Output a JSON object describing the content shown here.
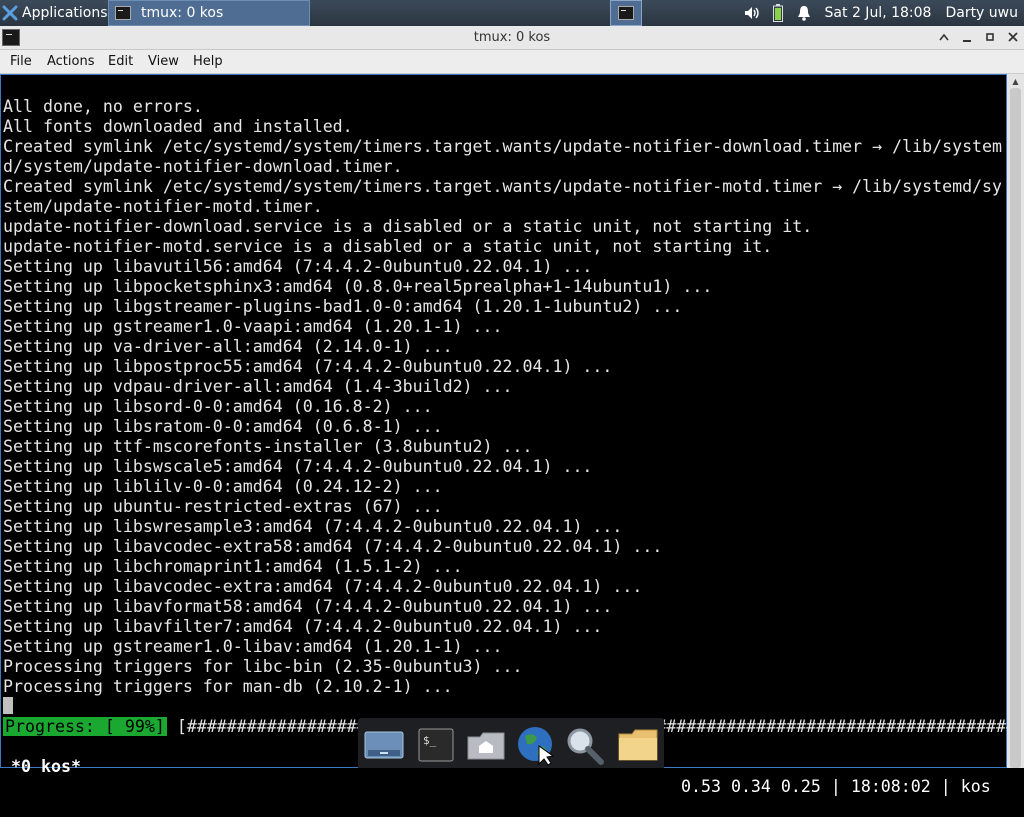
{
  "top_panel": {
    "applications_label": "Applications",
    "task_label": "tmux: 0 kos",
    "clock": "Sat  2 Jul, 18:08",
    "user": "Darty uwu"
  },
  "window": {
    "title": "tmux: 0 kos"
  },
  "menubar": {
    "items": [
      "File",
      "Actions",
      "Edit",
      "View",
      "Help"
    ]
  },
  "terminal": {
    "lines": [
      "All done, no errors.",
      "All fonts downloaded and installed.",
      "Created symlink /etc/systemd/system/timers.target.wants/update-notifier-download.timer → /lib/system",
      "d/system/update-notifier-download.timer.",
      "Created symlink /etc/systemd/system/timers.target.wants/update-notifier-motd.timer → /lib/systemd/sy",
      "stem/update-notifier-motd.timer.",
      "update-notifier-download.service is a disabled or a static unit, not starting it.",
      "update-notifier-motd.service is a disabled or a static unit, not starting it.",
      "Setting up libavutil56:amd64 (7:4.4.2-0ubuntu0.22.04.1) ...",
      "Setting up libpocketsphinx3:amd64 (0.8.0+real5prealpha+1-14ubuntu1) ...",
      "Setting up libgstreamer-plugins-bad1.0-0:amd64 (1.20.1-1ubuntu2) ...",
      "Setting up gstreamer1.0-vaapi:amd64 (1.20.1-1) ...",
      "Setting up va-driver-all:amd64 (2.14.0-1) ...",
      "Setting up libpostproc55:amd64 (7:4.4.2-0ubuntu0.22.04.1) ...",
      "Setting up vdpau-driver-all:amd64 (1.4-3build2) ...",
      "Setting up libsord-0-0:amd64 (0.16.8-2) ...",
      "Setting up libsratom-0-0:amd64 (0.6.8-1) ...",
      "Setting up ttf-mscorefonts-installer (3.8ubuntu2) ...",
      "Setting up libswscale5:amd64 (7:4.4.2-0ubuntu0.22.04.1) ...",
      "Setting up liblilv-0-0:amd64 (0.24.12-2) ...",
      "Setting up ubuntu-restricted-extras (67) ...",
      "Setting up libswresample3:amd64 (7:4.4.2-0ubuntu0.22.04.1) ...",
      "Setting up libavcodec-extra58:amd64 (7:4.4.2-0ubuntu0.22.04.1) ...",
      "Setting up libchromaprint1:amd64 (1.5.1-2) ...",
      "Setting up libavcodec-extra:amd64 (7:4.4.2-0ubuntu0.22.04.1) ...",
      "Setting up libavformat58:amd64 (7:4.4.2-0ubuntu0.22.04.1) ...",
      "Setting up libavfilter7:amd64 (7:4.4.2-0ubuntu0.22.04.1) ...",
      "Setting up gstreamer1.0-libav:amd64 (1.20.1-1) ...",
      "Processing triggers for libc-bin (2.35-0ubuntu3) ...",
      "Processing triggers for man-db (2.10.2-1) ..."
    ],
    "progress_label": "Progress: [ 99%]",
    "progress_bar": " [####################################################################################.]",
    "progress_fraction": 0.99
  },
  "tmux_status": {
    "window": "*0 kos*",
    "right": "0.53 0.34 0.25 | 18:08:02 | kos"
  },
  "dock": {
    "items": [
      "show-desktop-icon",
      "terminal-icon",
      "home-folder-icon",
      "web-browser-icon",
      "search-icon",
      "files-folder-icon"
    ]
  },
  "colors": {
    "panel": "#2f3b48",
    "accent": "#4f6d92",
    "progress_green": "#1aa830",
    "terminal_bg": "#000000",
    "terminal_fg": "#e6e6e6"
  }
}
